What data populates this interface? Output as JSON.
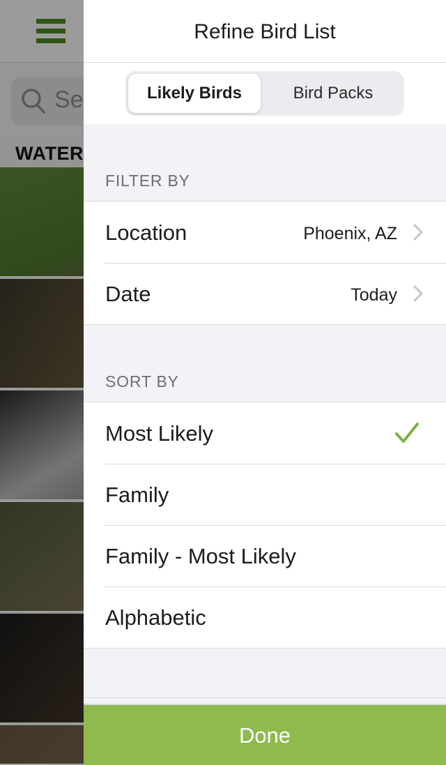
{
  "background": {
    "search_placeholder": "Sea",
    "section_header": "WATER"
  },
  "panel": {
    "title": "Refine Bird List",
    "segments": [
      {
        "label": "Likely Birds",
        "selected": true
      },
      {
        "label": "Bird Packs",
        "selected": false
      }
    ],
    "filter": {
      "header": "FILTER BY",
      "rows": [
        {
          "label": "Location",
          "value": "Phoenix, AZ"
        },
        {
          "label": "Date",
          "value": "Today"
        }
      ]
    },
    "sort": {
      "header": "SORT BY",
      "selected": "Most Likely",
      "rows": [
        {
          "label": "Most Likely"
        },
        {
          "label": "Family"
        },
        {
          "label": "Family - Most Likely"
        },
        {
          "label": "Alphabetic"
        }
      ]
    },
    "done_label": "Done"
  },
  "colors": {
    "accent_green": "#8fba4e",
    "check_green": "#7bb043",
    "brand_green": "#4c8a1e"
  },
  "icons": {
    "menu": "hamburger-icon",
    "search": "search-icon",
    "chevron": "chevron-right-icon",
    "check": "checkmark-icon"
  }
}
